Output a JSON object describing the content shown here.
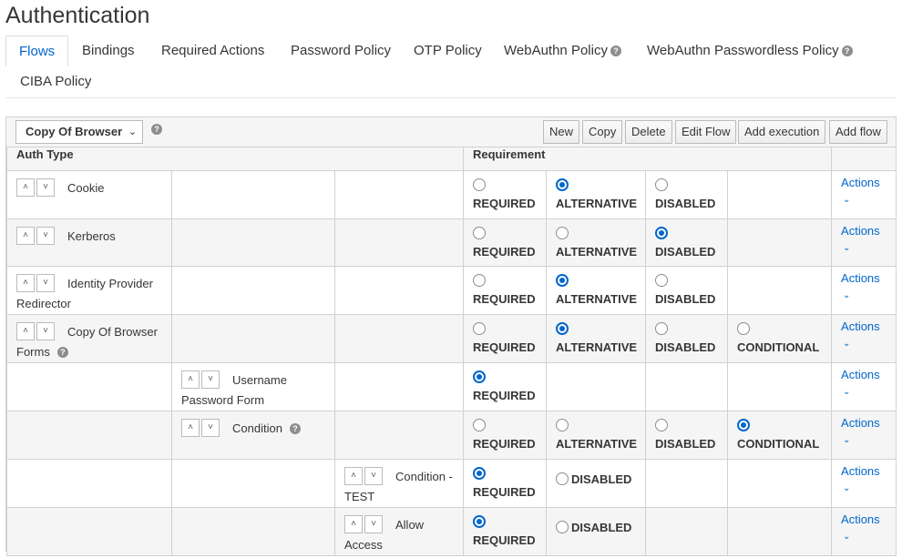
{
  "page": {
    "title": "Authentication"
  },
  "tabs": [
    {
      "label": "Flows"
    },
    {
      "label": "Bindings"
    },
    {
      "label": "Required Actions"
    },
    {
      "label": "Password Policy"
    },
    {
      "label": "OTP Policy"
    },
    {
      "label": "WebAuthn Policy"
    },
    {
      "label": "WebAuthn Passwordless Policy"
    },
    {
      "label": "CIBA Policy"
    }
  ],
  "toolbar": {
    "flow_select_value": "Copy Of Browser",
    "buttons": [
      "New",
      "Copy",
      "Delete",
      "Edit Flow",
      "Add execution",
      "Add flow"
    ]
  },
  "table": {
    "col_auth_type": "Auth Type",
    "col_requirement": "Requirement",
    "labels": {
      "required": "REQUIRED",
      "alternative": "ALTERNATIVE",
      "disabled": "DISABLED",
      "conditional": "CONDITIONAL",
      "actions": "Actions"
    },
    "rows": [
      {
        "name": "Cookie",
        "level": 0,
        "options": [
          "REQUIRED",
          "ALTERNATIVE",
          "DISABLED"
        ],
        "selected": "ALTERNATIVE"
      },
      {
        "name": "Kerberos",
        "level": 0,
        "options": [
          "REQUIRED",
          "ALTERNATIVE",
          "DISABLED"
        ],
        "selected": "DISABLED"
      },
      {
        "name": "Identity Provider Redirector",
        "level": 0,
        "options": [
          "REQUIRED",
          "ALTERNATIVE",
          "DISABLED"
        ],
        "selected": "ALTERNATIVE"
      },
      {
        "name": "Copy Of Browser Forms",
        "level": 0,
        "help": true,
        "options": [
          "REQUIRED",
          "ALTERNATIVE",
          "DISABLED",
          "CONDITIONAL"
        ],
        "selected": "ALTERNATIVE"
      },
      {
        "name": "Username Password Form",
        "level": 1,
        "options": [
          "REQUIRED"
        ],
        "selected": "REQUIRED"
      },
      {
        "name": "Condition",
        "level": 1,
        "help": true,
        "options": [
          "REQUIRED",
          "ALTERNATIVE",
          "DISABLED",
          "CONDITIONAL"
        ],
        "selected": "CONDITIONAL"
      },
      {
        "name": "Condition - TEST",
        "level": 2,
        "options": [
          "REQUIRED",
          "DISABLED"
        ],
        "selected": "REQUIRED"
      },
      {
        "name": "Allow Access",
        "level": 2,
        "options": [
          "REQUIRED",
          "DISABLED"
        ],
        "selected": "REQUIRED"
      }
    ]
  },
  "colors": {
    "link": "#0066cc",
    "radio_selected": "#0066cc",
    "row_alt": "#f5f5f5"
  }
}
